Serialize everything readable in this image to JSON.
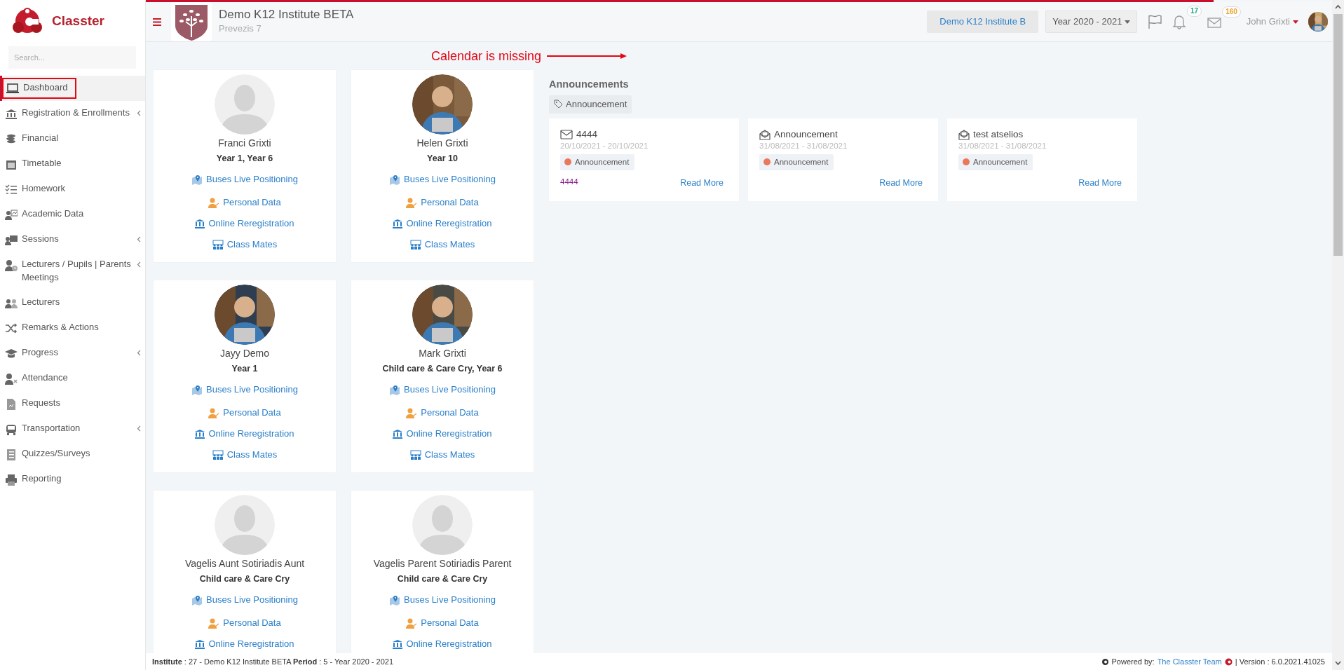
{
  "loading_bar": {
    "level": 0.9
  },
  "sidebar": {
    "brand": "Classter",
    "search": {
      "placeholder": "Search..."
    },
    "items": [
      {
        "label": "Dashboard",
        "selected": true,
        "has_submenu": false
      },
      {
        "label": "Registration & Enrollments",
        "selected": false,
        "has_submenu": true
      },
      {
        "label": "Financial",
        "selected": false,
        "has_submenu": false
      },
      {
        "label": "Timetable",
        "selected": false,
        "has_submenu": false
      },
      {
        "label": "Homework",
        "selected": false,
        "has_submenu": false
      },
      {
        "label": "Academic Data",
        "selected": false,
        "has_submenu": false
      },
      {
        "label": "Sessions",
        "selected": false,
        "has_submenu": true
      },
      {
        "label": "Lecturers / Pupils | Parents Meetings",
        "selected": false,
        "has_submenu": true
      },
      {
        "label": "Lecturers",
        "selected": false,
        "has_submenu": false
      },
      {
        "label": "Remarks & Actions",
        "selected": false,
        "has_submenu": false
      },
      {
        "label": "Progress",
        "selected": false,
        "has_submenu": true
      },
      {
        "label": "Attendance",
        "selected": false,
        "has_submenu": false
      },
      {
        "label": "Requests",
        "selected": false,
        "has_submenu": false
      },
      {
        "label": "Transportation",
        "selected": false,
        "has_submenu": true
      },
      {
        "label": "Quizzes/Surveys",
        "selected": false,
        "has_submenu": false
      },
      {
        "label": "Reporting",
        "selected": false,
        "has_submenu": false
      }
    ]
  },
  "header": {
    "title": "Demo K12 Institute BETA",
    "subtitle": "Prevezis 7",
    "institute_button": "Demo K12 Institute B",
    "year_select": "Year 2020 - 2021",
    "notifications": {
      "count": "17"
    },
    "messages": {
      "count": "160"
    },
    "user": "John Grixti"
  },
  "annotation": "Calendar is missing",
  "students": [
    {
      "name": "Franci Grixti",
      "classes": "Year 1, Year 6",
      "has_photo": false,
      "links": [
        "Buses Live Positioning",
        "Personal Data",
        "Online Reregistration",
        "Class Mates"
      ]
    },
    {
      "name": "Helen Grixti",
      "classes": "Year 10",
      "has_photo": true,
      "links": [
        "Buses Live Positioning",
        "Personal Data",
        "Online Reregistration",
        "Class Mates"
      ]
    },
    {
      "name": "Jayy Demo",
      "classes": "Year 1",
      "has_photo": true,
      "links": [
        "Buses Live Positioning",
        "Personal Data",
        "Online Reregistration",
        "Class Mates"
      ]
    },
    {
      "name": "Mark Grixti",
      "classes": "Child care & Care Cry, Year 6",
      "has_photo": true,
      "links": [
        "Buses Live Positioning",
        "Personal Data",
        "Online Reregistration",
        "Class Mates"
      ]
    },
    {
      "name": "Vagelis Aunt Sotiriadis Aunt",
      "classes": "Child care & Care Cry",
      "has_photo": false,
      "links": [
        "Buses Live Positioning",
        "Personal Data",
        "Online Reregistration"
      ]
    },
    {
      "name": "Vagelis Parent Sotiriadis Parent",
      "classes": "Child care & Care Cry",
      "has_photo": false,
      "links": [
        "Buses Live Positioning",
        "Personal Data",
        "Online Reregistration"
      ]
    }
  ],
  "announcements": {
    "title": "Announcements",
    "filter": "Announcement",
    "items": [
      {
        "title": "4444",
        "read": false,
        "dates": "20/10/2021 - 20/10/2021",
        "tag": {
          "label": "Announcement",
          "color": "#e8795a"
        },
        "body": "4444",
        "link": "Read More"
      },
      {
        "title": "Announcement",
        "read": true,
        "dates": "31/08/2021 - 31/08/2021",
        "tag": {
          "label": "Announcement",
          "color": "#e8795a"
        },
        "link": "Read More"
      },
      {
        "title": "test atselios",
        "read": true,
        "dates": "31/08/2021 - 31/08/2021",
        "tag": {
          "label": "Announcement",
          "color": "#e8795a"
        },
        "link": "Read More"
      }
    ]
  },
  "footer": {
    "info": "**Institute** : 27 - Demo K12 Institute BETA **Period** : 5 - Year 2020 - 2021",
    "powered_by": "Powered by:",
    "team_link": "The Classter Team",
    "version": "| Version : 6.0.2021.41025"
  }
}
